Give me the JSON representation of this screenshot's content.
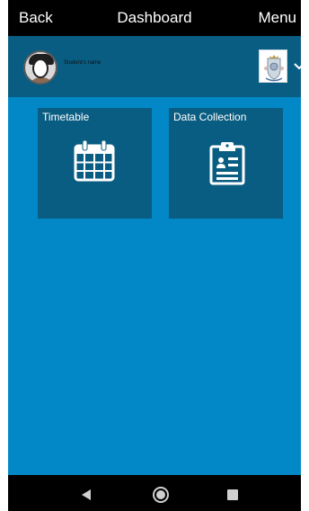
{
  "topbar": {
    "back_label": "Back",
    "title": "Dashboard",
    "menu_label": "Menu"
  },
  "user": {
    "name": "Student's name",
    "avatar_icon": "student-avatar",
    "logo_icon": "school-crest",
    "dropdown_icon": "chevron-down-icon"
  },
  "tiles": [
    {
      "label": "Timetable",
      "icon": "calendar-icon"
    },
    {
      "label": "Data Collection",
      "icon": "clipboard-icon"
    }
  ],
  "navbar": {
    "back_icon": "back-triangle-icon",
    "home_icon": "home-circle-icon",
    "recents_icon": "recents-square-icon"
  },
  "colors": {
    "background": "#0288c7",
    "panel": "#0a5d82",
    "bars": "#000000",
    "text": "#ffffff"
  }
}
